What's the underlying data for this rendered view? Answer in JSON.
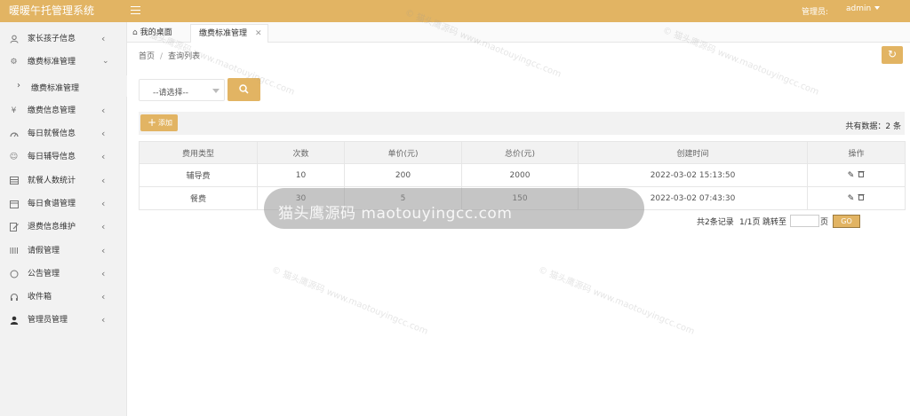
{
  "header": {
    "title": "暖暖午托管理系统",
    "admin_label": "管理员:",
    "admin_user": "admin"
  },
  "sidebar": {
    "items": [
      {
        "label": "家长孩子信息",
        "icon": "user-icon"
      },
      {
        "label": "缴费标准管理",
        "icon": "gear-icon"
      },
      {
        "label": "缴费信息管理",
        "icon": "yen-icon"
      },
      {
        "label": "每日就餐信息",
        "icon": "dashboard-icon"
      },
      {
        "label": "每日辅导信息",
        "icon": "smile-icon"
      },
      {
        "label": "就餐人数统计",
        "icon": "table-icon"
      },
      {
        "label": "每日食谱管理",
        "icon": "calendar-icon"
      },
      {
        "label": "退费信息维护",
        "icon": "edit-icon"
      },
      {
        "label": "请假管理",
        "icon": "bars-icon"
      },
      {
        "label": "公告管理",
        "icon": "chat-icon"
      },
      {
        "label": "收件箱",
        "icon": "headset-icon"
      },
      {
        "label": "管理员管理",
        "icon": "person-icon"
      }
    ],
    "sub_item": "缴费标准管理"
  },
  "tabs": [
    {
      "label": "我的桌面"
    },
    {
      "label": "缴费标准管理"
    }
  ],
  "breadcrumb": {
    "home": "首页",
    "current": "查询列表"
  },
  "filter": {
    "select_value": "--请选择--"
  },
  "toolbar": {
    "add_label": "添加",
    "total_label": "共有数据：2 条"
  },
  "table": {
    "columns": [
      "费用类型",
      "次数",
      "单价(元)",
      "总价(元)",
      "创建时间",
      "操作"
    ],
    "rows": [
      [
        "辅导费",
        "10",
        "200",
        "2000",
        "2022-03-02 15:13:50"
      ],
      [
        "餐费",
        "30",
        "5",
        "150",
        "2022-03-02 07:43:30"
      ]
    ]
  },
  "pager": {
    "records": "共2条记录",
    "pages": "1/1页",
    "jump": "跳转至",
    "unit": "页",
    "go": "GO"
  },
  "watermark": {
    "banner": "猫头鹰源码 maotouyingcc.com",
    "tile": "© 猫头鹰源码 www.maotouyingcc.com"
  },
  "colors": {
    "accent": "#e2b463"
  }
}
